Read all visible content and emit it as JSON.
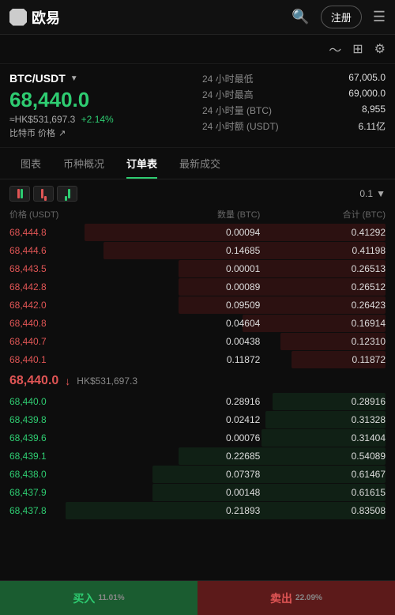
{
  "header": {
    "logo_text": "欧易",
    "register_label": "注册",
    "search_icon": "🔍",
    "menu_icon": "☰"
  },
  "sub_header": {
    "chart_icon": "📈",
    "grid_icon": "⊞",
    "settings_icon": "⚙"
  },
  "ticker": {
    "pair": "BTC/USDT",
    "price": "68,440.0",
    "hk_price": "≈HK$531,697.3",
    "change_pct": "+2.14%",
    "label": "比特币 价格",
    "stat_low_label": "24 小时最低",
    "stat_low_val": "67,005.0",
    "stat_high_label": "24 小时最高",
    "stat_high_val": "69,000.0",
    "stat_vol_btc_label": "24 小时量 (BTC)",
    "stat_vol_btc_val": "8,955",
    "stat_vol_usdt_label": "24 小时额 (USDT)",
    "stat_vol_usdt_val": "6.11亿"
  },
  "tabs": [
    {
      "id": "chart",
      "label": "图表"
    },
    {
      "id": "market",
      "label": "币种概况"
    },
    {
      "id": "orderbook",
      "label": "订单表",
      "active": true
    },
    {
      "id": "trades",
      "label": "最新成交"
    }
  ],
  "orderbook": {
    "precision": "0.1",
    "headers": {
      "price": "价格 (USDT)",
      "qty": "数量 (BTC)",
      "total": "合计 (BTC)"
    },
    "asks": [
      {
        "price": "68,444.8",
        "qty": "0.00094",
        "total": "0.41292",
        "depth": 80
      },
      {
        "price": "68,444.6",
        "qty": "0.14685",
        "total": "0.41198",
        "depth": 75
      },
      {
        "price": "68,443.5",
        "qty": "0.00001",
        "total": "0.26513",
        "depth": 55
      },
      {
        "price": "68,442.8",
        "qty": "0.00089",
        "total": "0.26512",
        "depth": 55
      },
      {
        "price": "68,442.0",
        "qty": "0.09509",
        "total": "0.26423",
        "depth": 55
      },
      {
        "price": "68,440.8",
        "qty": "0.04604",
        "total": "0.16914",
        "depth": 38
      },
      {
        "price": "68,440.7",
        "qty": "0.00438",
        "total": "0.12310",
        "depth": 28
      },
      {
        "price": "68,440.1",
        "qty": "0.11872",
        "total": "0.11872",
        "depth": 25
      }
    ],
    "mid_price": "68,440.0",
    "mid_hk": "HK$531,697.3",
    "bids": [
      {
        "price": "68,440.0",
        "qty": "0.28916",
        "total": "0.28916",
        "depth": 30
      },
      {
        "price": "68,439.8",
        "qty": "0.02412",
        "total": "0.31328",
        "depth": 32
      },
      {
        "price": "68,439.6",
        "qty": "0.00076",
        "total": "0.31404",
        "depth": 33
      },
      {
        "price": "68,439.1",
        "qty": "0.22685",
        "total": "0.54089",
        "depth": 55
      },
      {
        "price": "68,438.0",
        "qty": "0.07378",
        "total": "0.61467",
        "depth": 62
      },
      {
        "price": "68,437.9",
        "qty": "0.00148",
        "total": "0.61615",
        "depth": 62
      },
      {
        "price": "68,437.8",
        "qty": "0.21893",
        "total": "0.83508",
        "depth": 85
      }
    ]
  },
  "bottom": {
    "buy_label": "买入",
    "buy_pct": "11.01%",
    "sell_label": "卖出",
    "sell_pct": "22.09%"
  }
}
